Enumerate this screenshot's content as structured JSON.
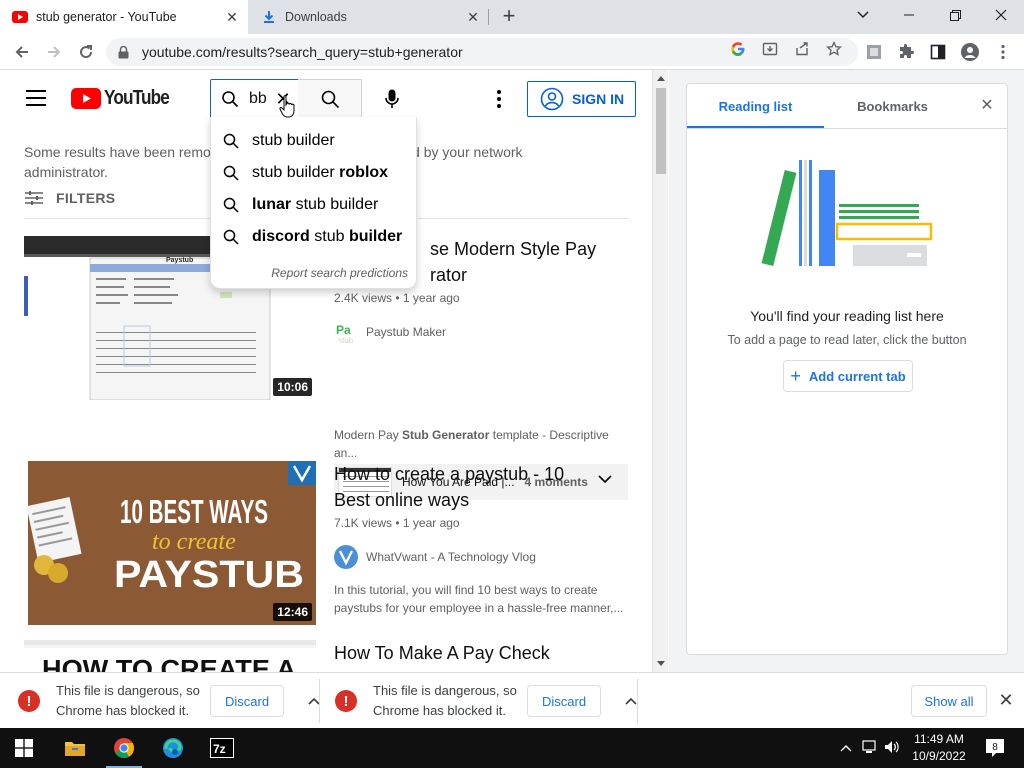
{
  "browser": {
    "tabs": [
      {
        "title": "stub generator - YouTube",
        "icon": "youtube-icon",
        "active": true
      },
      {
        "title": "Downloads",
        "icon": "download-icon",
        "active": false
      }
    ],
    "new_tab": "+",
    "url": "youtube.com/results?search_query=stub+generator"
  },
  "youtube": {
    "logo_text": "YouTube",
    "search_value": "bb",
    "signin_label": "SIGN IN",
    "notice": "Some results have been removed because Restricted Mode is enabled by your network administrator.",
    "notice_line1": "Some results have been remov",
    "notice_line1_tail": "nabled by your network",
    "notice_line2": "administrator.",
    "filters_label": "FILTERS",
    "suggestions": [
      {
        "prefix": "",
        "plain": "stub builder",
        "bold": ""
      },
      {
        "prefix": "",
        "plain": "stub builder ",
        "bold": "roblox"
      },
      {
        "prefix": "lunar",
        "plain": " stub builder",
        "bold": ""
      },
      {
        "prefix": "discord",
        "plain": " stub ",
        "bold": "builder"
      }
    ],
    "report_label": "Report search predictions",
    "results": [
      {
        "title_visible": "se Modern Style Pay",
        "title_line2": "rator",
        "meta": "2.4K views • 1 year ago",
        "channel": "Paystub Maker",
        "desc_pre": "Modern Pay ",
        "desc_bold": "Stub Generator",
        "desc_post": " template - Descriptive an...",
        "duration": "10:06",
        "thumb_header": "Paystub",
        "moments_title": "How You Are Paid |...",
        "moments_count": "4 moments"
      },
      {
        "title": "How to create a paystub - 10 Best online ways",
        "meta": "7.1K views • 1 year ago",
        "channel": "WhatVwant - A Technology Vlog",
        "desc": "In this tutorial, you will find 10 best ways to create paystubs for your employee in a hassle-free manner,...",
        "duration": "12:46",
        "thumb_line1": "10 BEST WAYS",
        "thumb_line2": "to create",
        "thumb_line3": "PAYSTUB"
      },
      {
        "title": "How To Make A Pay Check",
        "thumb_text": "HOW TO CREATE A"
      }
    ]
  },
  "side_panel": {
    "tabs": [
      "Reading list",
      "Bookmarks"
    ],
    "heading": "You'll find your reading list here",
    "subtext": "To add a page to read later, click the button",
    "add_button": "Add current tab"
  },
  "downloads": {
    "items": [
      {
        "line1": "This file is dangerous, so",
        "line2": "Chrome has blocked it.",
        "action": "Discard"
      },
      {
        "line1": "This file is dangerous, so",
        "line2": "Chrome has blocked it.",
        "action": "Discard"
      }
    ],
    "show_all": "Show all"
  },
  "taskbar": {
    "time": "11:49 AM",
    "date": "10/9/2022",
    "notification_count": "8",
    "apps": [
      "windows-start-icon",
      "file-explorer-icon",
      "chrome-icon",
      "edge-icon",
      "7zip-icon"
    ]
  },
  "colors": {
    "youtube_red": "#ff0000",
    "link_blue": "#065fd4",
    "chrome_blue": "#1a73e8",
    "danger_red": "#d93025"
  }
}
